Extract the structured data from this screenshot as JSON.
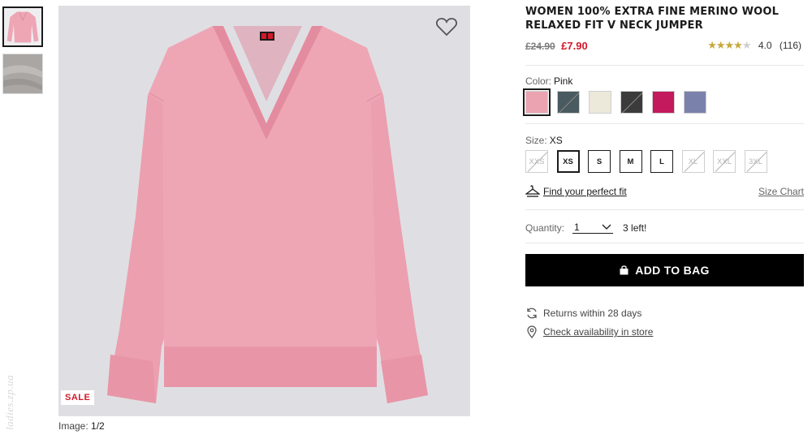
{
  "product": {
    "title": "WOMEN 100% EXTRA FINE MERINO WOOL RELAXED FIT V NECK JUMPER",
    "old_price": "£24.90",
    "sale_price": "£7.90",
    "rating": {
      "stars_filled": 4,
      "stars_total": 5,
      "score": "4.0",
      "count": "(116)"
    },
    "sale_badge": "SALE",
    "image_counter_label": "Image:",
    "image_counter_value": "1/2",
    "logo": "UNIQLO"
  },
  "color": {
    "label": "Color:",
    "selected": "Pink",
    "swatches": [
      {
        "name": "pink",
        "hex": "#eba3b1",
        "available": true,
        "selected": true
      },
      {
        "name": "dark-teal",
        "hex": "#495a60",
        "available": false
      },
      {
        "name": "off-white",
        "hex": "#ece8da",
        "available": true
      },
      {
        "name": "charcoal",
        "hex": "#3b3b3b",
        "available": false
      },
      {
        "name": "magenta",
        "hex": "#c21a5c",
        "available": true
      },
      {
        "name": "periwinkle",
        "hex": "#7a82ab",
        "available": true
      }
    ]
  },
  "size": {
    "label": "Size:",
    "selected": "XS",
    "options": [
      {
        "label": "XXS",
        "available": false
      },
      {
        "label": "XS",
        "available": true,
        "selected": true
      },
      {
        "label": "S",
        "available": true
      },
      {
        "label": "M",
        "available": true
      },
      {
        "label": "L",
        "available": true
      },
      {
        "label": "XL",
        "available": false
      },
      {
        "label": "XXL",
        "available": false
      },
      {
        "label": "3XL",
        "available": false
      }
    ],
    "fit_link": "Find your perfect fit",
    "size_chart": "Size Chart"
  },
  "quantity": {
    "label": "Quantity:",
    "value": "1",
    "stock_note": "3 left!"
  },
  "add_to_bag": "ADD TO BAG",
  "services": {
    "returns": "Returns within 28 days",
    "store": "Check availability in store"
  },
  "watermark": "ladies.zp.ua",
  "colors": {
    "accent_red": "#d3182a",
    "star_gold": "#c6a93a",
    "button_black": "#000000",
    "image_bg": "#dfdfe3",
    "sweater_pink": "#eea6b5"
  }
}
